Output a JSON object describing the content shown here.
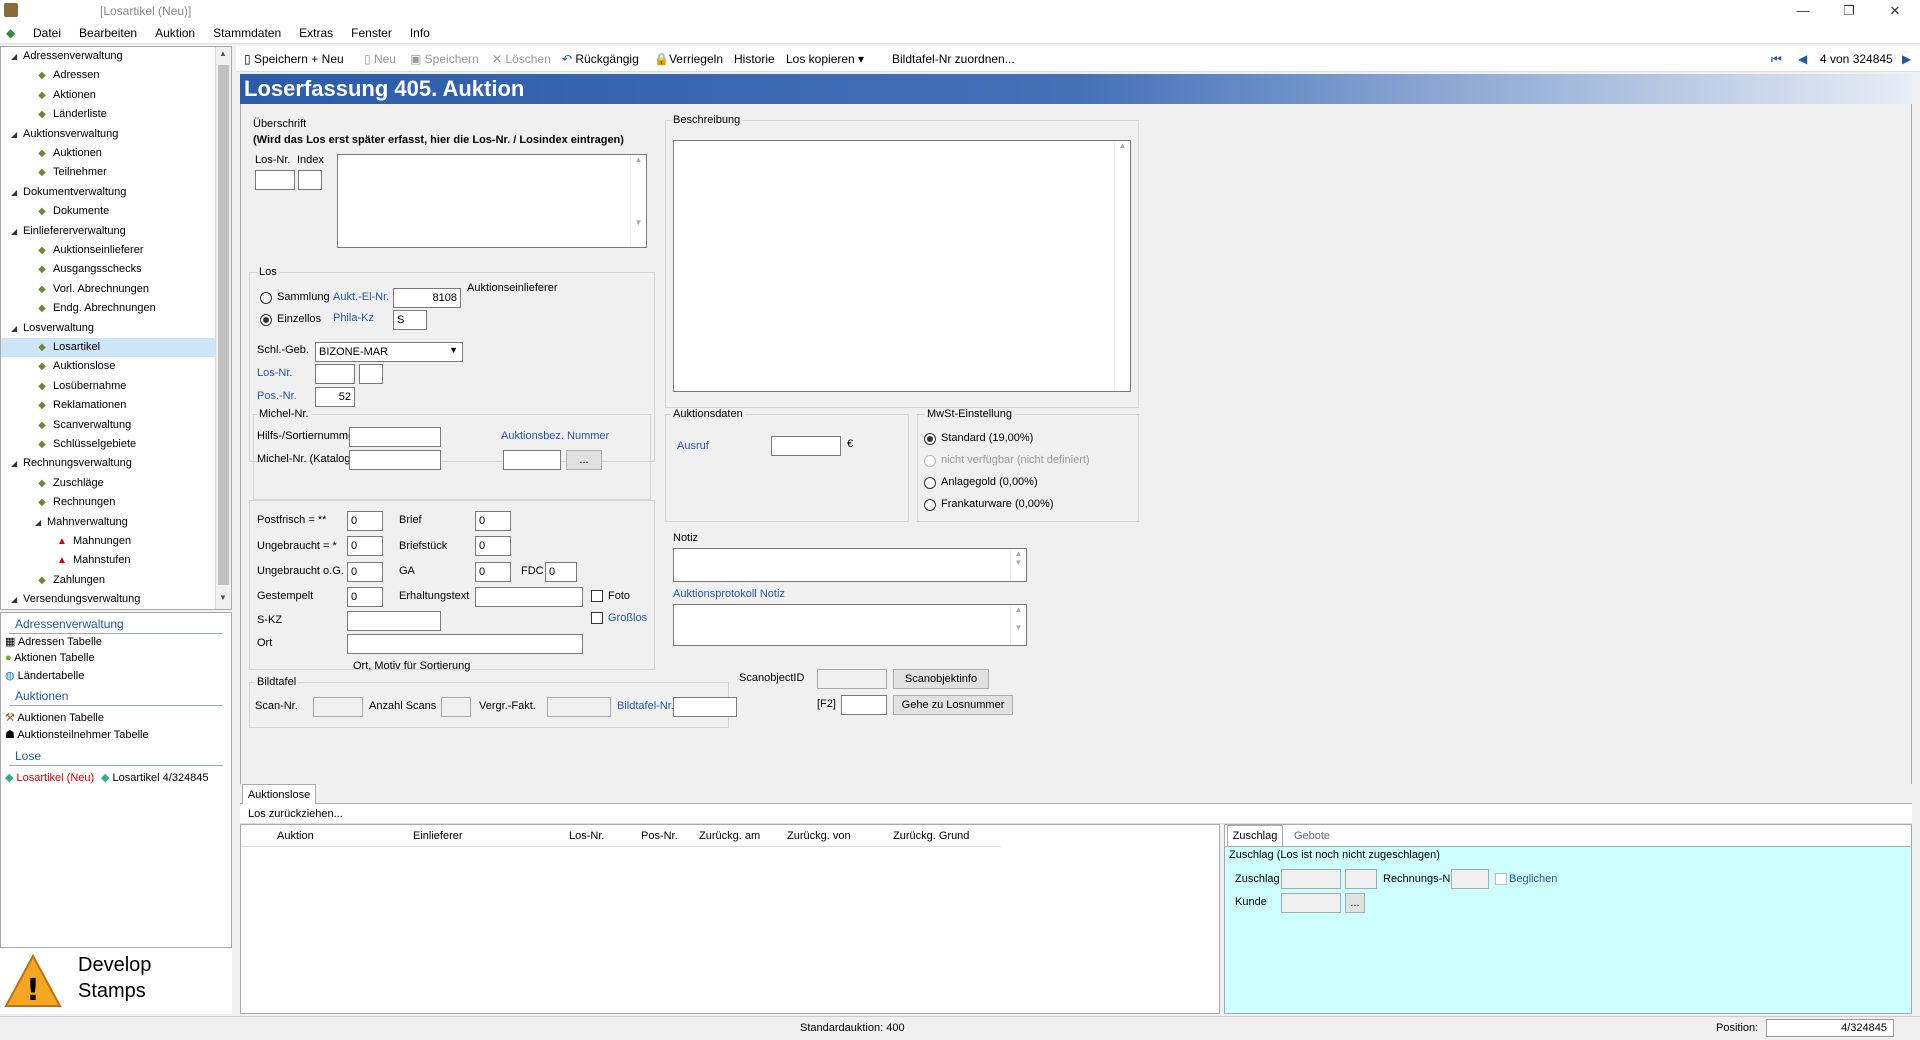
{
  "window": {
    "title": "[Losartikel (Neu)]",
    "min": "—",
    "max": "❐",
    "close": "✕"
  },
  "menu": [
    "Datei",
    "Bearbeiten",
    "Auktion",
    "Stammdaten",
    "Extras",
    "Fenster",
    "Info"
  ],
  "tree": [
    {
      "label": "Adressenverwaltung",
      "level": 0
    },
    {
      "label": "Adressen",
      "level": 1
    },
    {
      "label": "Aktionen",
      "level": 1
    },
    {
      "label": "Länderliste",
      "level": 1
    },
    {
      "label": "Auktionsverwaltung",
      "level": 0
    },
    {
      "label": "Auktionen",
      "level": 1
    },
    {
      "label": "Teilnehmer",
      "level": 1
    },
    {
      "label": "Dokumentverwaltung",
      "level": 0
    },
    {
      "label": "Dokumente",
      "level": 1
    },
    {
      "label": "Einliefererverwaltung",
      "level": 0
    },
    {
      "label": "Auktionseinlieferer",
      "level": 1
    },
    {
      "label": "Ausgangsschecks",
      "level": 1
    },
    {
      "label": "Vorl. Abrechnungen",
      "level": 1
    },
    {
      "label": "Endg. Abrechnungen",
      "level": 1
    },
    {
      "label": "Losverwaltung",
      "level": 0
    },
    {
      "label": "Losartikel",
      "level": 1,
      "selected": true
    },
    {
      "label": "Auktionslose",
      "level": 1
    },
    {
      "label": "Losübernahme",
      "level": 1
    },
    {
      "label": "Reklamationen",
      "level": 1
    },
    {
      "label": "Scanverwaltung",
      "level": 1
    },
    {
      "label": "Schlüsselgebiete",
      "level": 1
    },
    {
      "label": "Rechnungsverwaltung",
      "level": 0
    },
    {
      "label": "Zuschläge",
      "level": 1
    },
    {
      "label": "Rechnungen",
      "level": 1
    },
    {
      "label": "Mahnverwaltung",
      "level": 1
    },
    {
      "label": "Mahnungen",
      "level": 2
    },
    {
      "label": "Mahnstufen",
      "level": 2
    },
    {
      "label": "Zahlungen",
      "level": 1
    },
    {
      "label": "Versendungsverwaltung",
      "level": 0
    }
  ],
  "shortcuts": {
    "h1": "Adressenverwaltung",
    "i1": "Adressen Tabelle",
    "i2": "Aktionen Tabelle",
    "i3": "Ländertabelle",
    "h2": "Auktionen",
    "i4": "Auktionen Tabelle",
    "i5": "Auktionsteilnehmer Tabelle",
    "h3": "Lose",
    "i6": "Losartikel (Neu)",
    "i7": "Losartikel 4/324845"
  },
  "logo": {
    "line1": "Develop",
    "line2": "Stamps"
  },
  "toolbar": {
    "save_new": "Speichern + Neu",
    "new": "Neu",
    "save": "Speichern",
    "delete": "Löschen",
    "undo": "Rückgängig",
    "lock": "Verriegeln",
    "history": "Historie",
    "copy": "Los kopieren",
    "assign": "Bildtafel-Nr zuordnen...",
    "nav": "4 von 324845"
  },
  "banner": "Loserfassung 405. Auktion",
  "form": {
    "ueberschrift": "Überschrift",
    "hint": "(Wird das Los erst später erfasst, hier die Los-Nr. / Losindex eintragen)",
    "losnr": "Los-Nr.",
    "index": "Index",
    "los": "Los",
    "sammlung": "Sammlung",
    "einzellos": "Einzellos",
    "aukt_el_nr": "Aukt.-El-Nr.",
    "aukt_el_val": "8108",
    "auktionseinlieferer": "Auktionseinlieferer",
    "phila_kz": "Phila-Kz",
    "phila_val": "S",
    "schl_geb": "Schl.-Geb.",
    "schl_val": "BIZONE-MAR",
    "los_nr2": "Los-Nr.",
    "pos_nr": "Pos.-Nr.",
    "pos_val": "52",
    "michel": "Michel-Nr.",
    "hilfs": "Hilfs-/Sortiernummer",
    "michel_kat": "Michel-Nr. (Katalog)",
    "auktionsbez": "Auktionsbez. Nummer",
    "dots": "...",
    "postfrisch": "Postfrisch = **",
    "ungebraucht": "Ungebraucht = *",
    "ungebraucht_og": "Ungebraucht o.G.",
    "gestempelt": "Gestempelt",
    "skz": "S-KZ",
    "ort": "Ort",
    "brief": "Brief",
    "briefstueck": "Briefstück",
    "ga": "GA",
    "fdc": "FDC",
    "erhaltung": "Erhaltungstext",
    "foto": "Foto",
    "grosslos": "Großlos",
    "ort_hint": "Ort, Motiv für Sortierung",
    "zero": "0",
    "bildtafel": "Bildtafel",
    "scan_nr": "Scan-Nr.",
    "anzahl_scans": "Anzahl Scans",
    "vergr": "Vergr.-Fakt.",
    "bildtafel_nr": "Bildtafel-Nr.",
    "beschreibung": "Beschreibung",
    "auktionsdaten": "Auktionsdaten",
    "ausruf": "Ausruf",
    "euro": "€",
    "mwst": "MwSt-Einstellung",
    "mwst1": "Standard (19,00%)",
    "mwst2": "nicht verfügbar (nicht definiert)",
    "mwst3": "Anlagegold (0,00%)",
    "mwst4": "Frankaturware (0,00%)",
    "notiz": "Notiz",
    "protokoll": "Auktionsprotokoll Notiz",
    "scanobjectid": "ScanobjectID",
    "scanobjektinfo": "Scanobjektinfo",
    "f2": "[F2]",
    "gehe_zu": "Gehe zu Losnummer"
  },
  "bottom": {
    "tab": "Auktionslose",
    "action": "Los zurückziehen...",
    "cols": [
      "Auktion",
      "Einlieferer",
      "Los-Nr.",
      "Pos-Nr.",
      "Zurückg. am",
      "Zurückg. von",
      "Zurückg. Grund"
    ],
    "tab_zuschlag": "Zuschlag",
    "tab_gebote": "Gebote",
    "zuschlag_hint": "Zuschlag (Los ist noch nicht zugeschlagen)",
    "zuschlag": "Zuschlag",
    "rechnungs_nr": "Rechnungs-Nr.",
    "beglichen": "Beglichen",
    "kunde": "Kunde"
  },
  "status": {
    "default": "Standardauktion: 400",
    "position_label": "Position:",
    "position_val": "4/324845"
  }
}
